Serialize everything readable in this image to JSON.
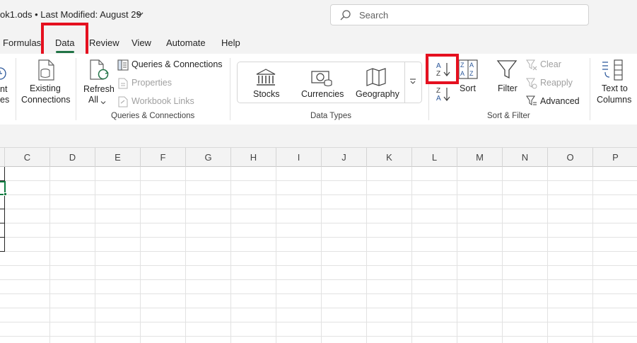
{
  "titlebar": {
    "doc_title": "ok1.ods  •  Last Modified: August 29",
    "search_placeholder": "Search"
  },
  "tabs": [
    {
      "label": "Formulas"
    },
    {
      "label": "Data"
    },
    {
      "label": "Review"
    },
    {
      "label": "View"
    },
    {
      "label": "Automate"
    },
    {
      "label": "Help"
    }
  ],
  "ribbon": {
    "get_data": {
      "partial1": "nt",
      "partial2": "es"
    },
    "existing_connections": {
      "line1": "Existing",
      "line2": "Connections"
    },
    "refresh_all": {
      "line1": "Refresh",
      "line2": "All"
    },
    "queries": {
      "queries_connections": "Queries & Connections",
      "properties": "Properties",
      "workbook_links": "Workbook Links",
      "group_label": "Queries & Connections"
    },
    "data_types": {
      "stocks": "Stocks",
      "currencies": "Currencies",
      "geography": "Geography",
      "group_label": "Data Types"
    },
    "sort_filter": {
      "sort": "Sort",
      "filter": "Filter",
      "clear": "Clear",
      "reapply": "Reapply",
      "advanced": "Advanced",
      "group_label": "Sort & Filter"
    },
    "text_to_columns": {
      "line1": "Text to",
      "line2": "Columns"
    }
  },
  "grid": {
    "columns": [
      "C",
      "D",
      "E",
      "F",
      "G",
      "H",
      "I",
      "J",
      "K",
      "L",
      "M",
      "N",
      "O",
      "P"
    ]
  },
  "colors": {
    "accent_green": "#217346",
    "highlight_red": "#e5101f",
    "data_type_blue": "#2b579a"
  }
}
